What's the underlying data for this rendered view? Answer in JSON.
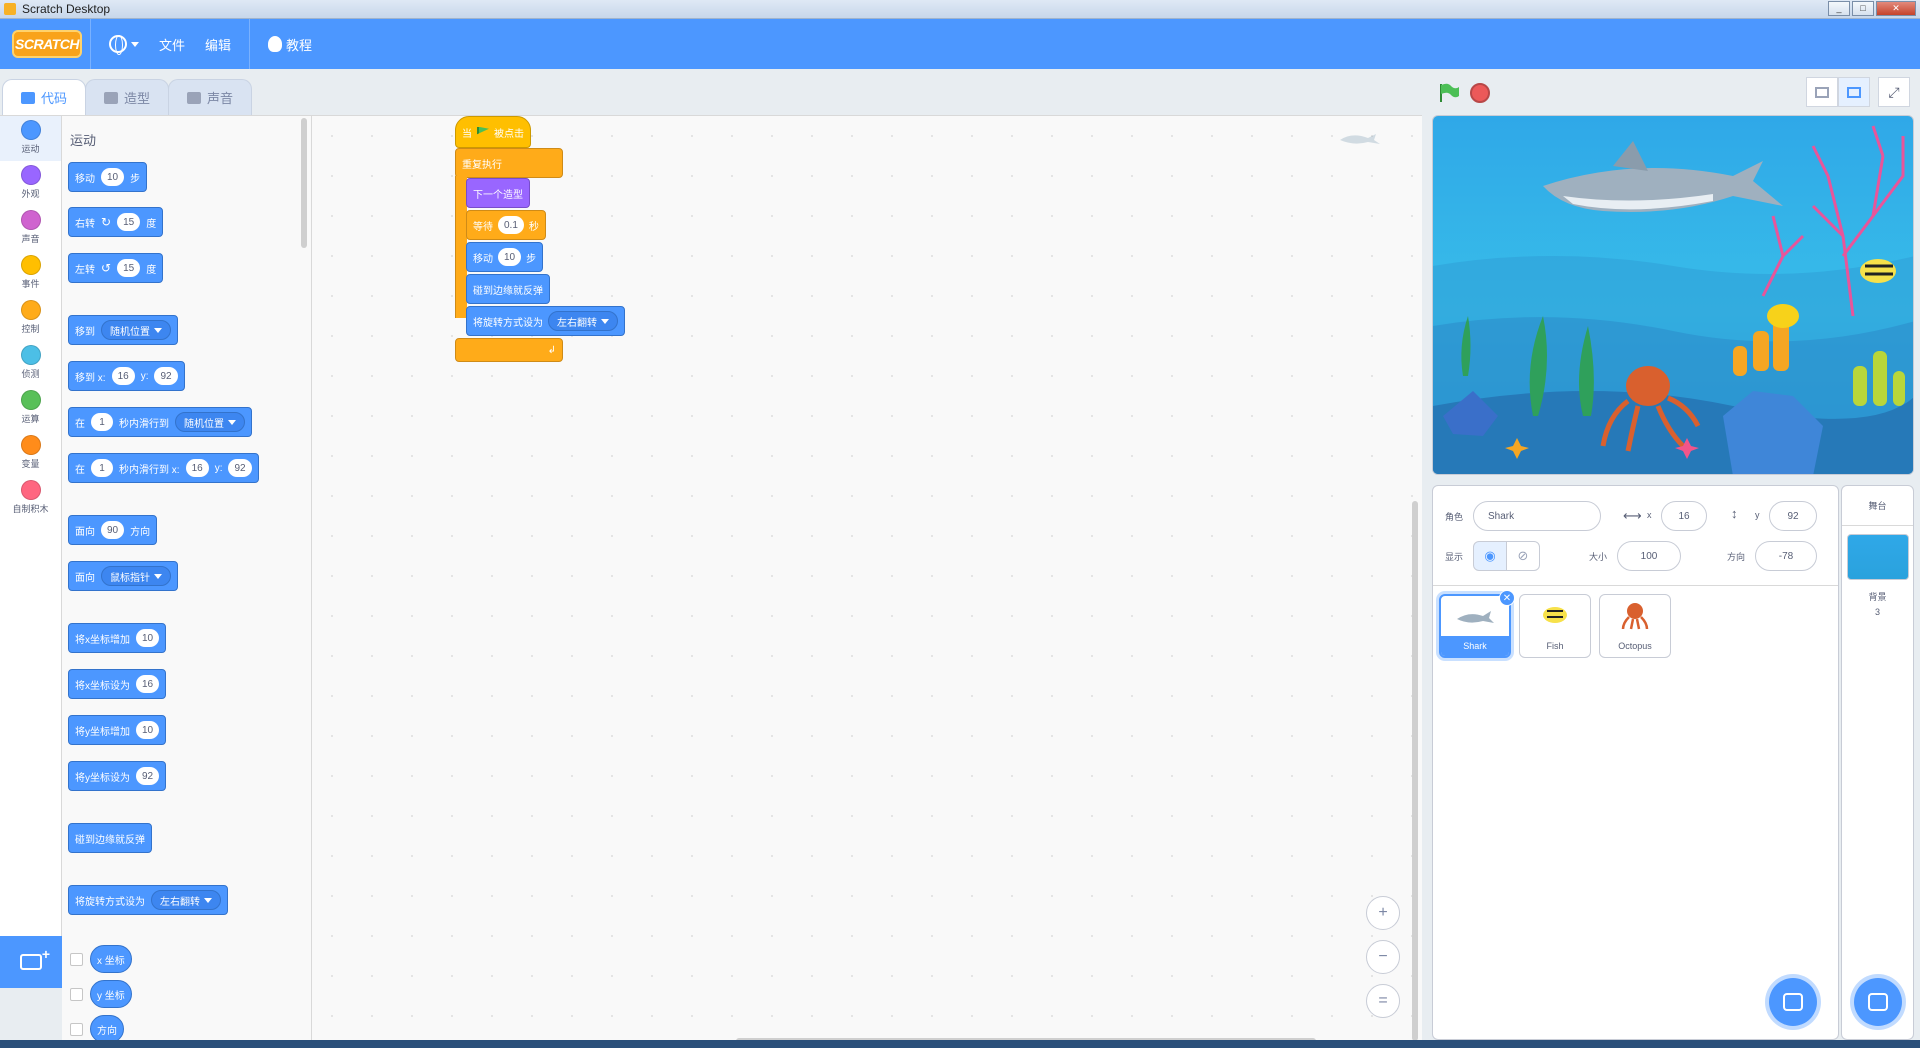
{
  "window": {
    "title": "Scratch Desktop"
  },
  "menubar": {
    "logo": "SCRATCH",
    "file": "文件",
    "edit": "编辑",
    "tutorials": "教程"
  },
  "tabs": [
    {
      "label": "代码"
    },
    {
      "label": "造型"
    },
    {
      "label": "声音"
    }
  ],
  "categories": [
    {
      "label": "运动",
      "color": "#4c97ff"
    },
    {
      "label": "外观",
      "color": "#9966ff"
    },
    {
      "label": "声音",
      "color": "#cf63cf"
    },
    {
      "label": "事件",
      "color": "#ffbf00"
    },
    {
      "label": "控制",
      "color": "#ffab19"
    },
    {
      "label": "侦测",
      "color": "#4cbfe6"
    },
    {
      "label": "运算",
      "color": "#59c059"
    },
    {
      "label": "变量",
      "color": "#ff8c1a"
    },
    {
      "label": "自制积木",
      "color": "#ff6680"
    }
  ],
  "palette": {
    "section_title": "运动",
    "move": {
      "a": "移动",
      "v": "10",
      "b": "步"
    },
    "turn_right": {
      "a": "右转",
      "v": "15",
      "b": "度"
    },
    "turn_left": {
      "a": "左转",
      "v": "15",
      "b": "度"
    },
    "goto": {
      "a": "移到",
      "dd": "随机位置"
    },
    "goto_xy": {
      "a": "移到 x:",
      "x": "16",
      "b": "y:",
      "y": "92"
    },
    "glide_to": {
      "a": "在",
      "v": "1",
      "b": "秒内滑行到",
      "dd": "随机位置"
    },
    "glide_xy": {
      "a": "在",
      "v": "1",
      "b": "秒内滑行到 x:",
      "x": "16",
      "c": "y:",
      "y": "92"
    },
    "point_dir": {
      "a": "面向",
      "v": "90",
      "b": "方向"
    },
    "point_towards": {
      "a": "面向",
      "dd": "鼠标指针"
    },
    "change_x": {
      "a": "将x坐标增加",
      "v": "10"
    },
    "set_x": {
      "a": "将x坐标设为",
      "v": "16"
    },
    "change_y": {
      "a": "将y坐标增加",
      "v": "10"
    },
    "set_y": {
      "a": "将y坐标设为",
      "v": "92"
    },
    "bounce": {
      "a": "碰到边缘就反弹"
    },
    "rotation_style": {
      "a": "将旋转方式设为",
      "dd": "左右翻转"
    },
    "reporters": [
      "x 坐标",
      "y 坐标",
      "方向"
    ]
  },
  "script": {
    "hat": {
      "a": "当",
      "b": "被点击"
    },
    "forever": "重复执行",
    "next_costume": "下一个造型",
    "wait": {
      "a": "等待",
      "v": "0.1",
      "b": "秒"
    },
    "move": {
      "a": "移动",
      "v": "10",
      "b": "步"
    },
    "bounce": "碰到边缘就反弹",
    "rotation": {
      "a": "将旋转方式设为",
      "dd": "左右翻转"
    }
  },
  "zoom": {
    "in": "+",
    "out": "−",
    "reset": "="
  },
  "sprite_info": {
    "sprite_label": "角色",
    "sprite_name": "Shark",
    "x_label": "x",
    "x": "16",
    "y_label": "y",
    "y": "92",
    "show_label": "显示",
    "size_label": "大小",
    "size": "100",
    "direction_label": "方向",
    "direction": "-78"
  },
  "sprites": [
    {
      "name": "Shark",
      "selected": true
    },
    {
      "name": "Fish",
      "selected": false
    },
    {
      "name": "Octopus",
      "selected": false
    }
  ],
  "stage_pane": {
    "header": "舞台",
    "backdrop_label": "背景",
    "backdrop_count": "3"
  }
}
